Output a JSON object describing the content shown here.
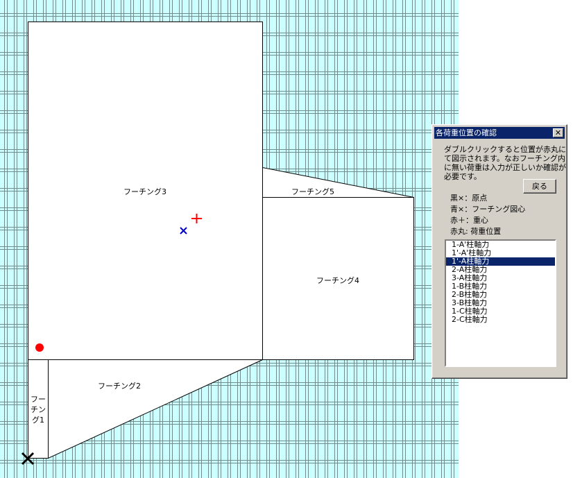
{
  "footings": {
    "f1": "フーチング1",
    "f2": "フーチング2",
    "f3": "フーチング3",
    "f4": "フーチング4",
    "f5": "フーチング5"
  },
  "dialog": {
    "title": "各荷重位置の確認",
    "close": "✕",
    "description": "ダブルクリックすると位置が赤丸にて図示されます。なおフーチング内に無い荷重は入力が正しいか確認が必要です。",
    "back_button": "戻る",
    "legend": {
      "black_x": "黒×：原点",
      "blue_x": "青×：フーチング図心",
      "red_plus": "赤＋：重心",
      "red_circle": "赤丸: 荷重位置"
    },
    "list": {
      "items": [
        "1-A'柱軸力",
        "1'-A'柱軸力",
        "1'-A柱軸力",
        "2-A柱軸力",
        "3-A柱軸力",
        "1-B柱軸力",
        "2-B柱軸力",
        "3-B柱軸力",
        "1-C柱軸力",
        "2-C柱軸力"
      ],
      "selected_index": 2
    }
  },
  "colors": {
    "grid_background": "#ccffff",
    "origin_marker": "#000000",
    "centroid_marker": "#0000cc",
    "center_of_gravity": "#ff0000",
    "load_position": "#ff0000",
    "selection": "#0a246a"
  },
  "icons": {
    "origin": "x-mark-icon",
    "centroid": "x-mark-icon",
    "center_of_gravity": "plus-icon",
    "load": "circle-icon"
  }
}
